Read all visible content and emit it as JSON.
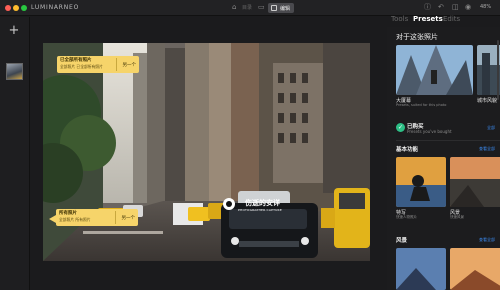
{
  "window": {
    "app_name": "LUMINARNEO",
    "toolbar": {
      "catalog_label": "目录",
      "edit_label": "编辑",
      "zoom": "48%"
    }
  },
  "tabs": [
    {
      "label": "Tools",
      "active": false
    },
    {
      "label": "Presets",
      "active": true
    },
    {
      "label": "Edits",
      "active": false
    }
  ],
  "callouts": {
    "top": {
      "title": "已全部所有照片",
      "subtitle": "全部照片 已全部所有照片",
      "button": "另一个"
    },
    "bottom": {
      "title": "所有照片",
      "subtitle": "全部照片 所有照片",
      "button": "另一个"
    }
  },
  "watermark": {
    "title": "伤逝的安详",
    "subtitle": "PHOTOGRAPHER·CAPTURE"
  },
  "panel": {
    "for_photo_title": "对于这张照片",
    "for_photo_cards": [
      {
        "label": "大厦幕",
        "sub": "Presets, suited for this photo"
      },
      {
        "label": "城市风貌",
        "sub": "Presets"
      }
    ],
    "bought": {
      "title": "已购买",
      "sub": "Presets you've bought",
      "see_all": "全部"
    },
    "basic": {
      "title": "基本功能",
      "see_all": "查看全部",
      "cards": [
        {
          "label": "特写",
          "sub": "快速人物照片"
        },
        {
          "label": "风景",
          "sub": "快速风景"
        }
      ]
    },
    "landscape": {
      "title": "风景",
      "see_all": "查看全部"
    }
  },
  "colors": {
    "accent": "#3b8cf3",
    "callout": "#f6d46a",
    "bought_badge": "#2dbf86"
  }
}
